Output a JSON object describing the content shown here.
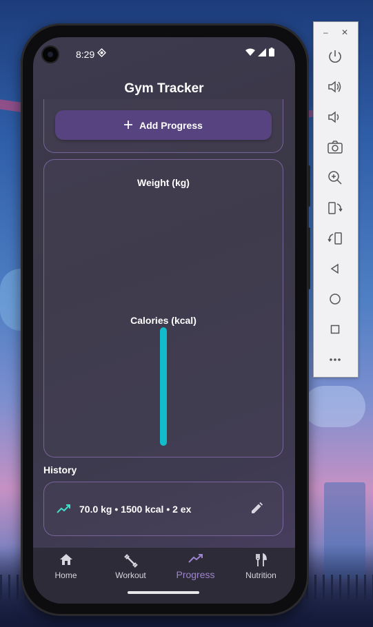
{
  "status_bar": {
    "time": "8:29"
  },
  "app": {
    "title": "Gym Tracker"
  },
  "add_progress": {
    "label": "Add Progress"
  },
  "chart": {
    "weight_title": "Weight (kg)",
    "calories_title": "Calories (kcal)"
  },
  "chart_data": {
    "type": "bar",
    "charts": [
      {
        "title": "Weight (kg)",
        "values": []
      },
      {
        "title": "Calories (kcal)",
        "values": [
          1500
        ]
      }
    ]
  },
  "history": {
    "label": "History",
    "items": [
      {
        "text": "70.0 kg • 1500 kcal • 2 ex"
      }
    ]
  },
  "nav": {
    "items": [
      {
        "label": "Home",
        "icon": "home-icon"
      },
      {
        "label": "Workout",
        "icon": "dumbbell-icon"
      },
      {
        "label": "Progress",
        "icon": "trending-up-icon",
        "active": true
      },
      {
        "label": "Nutrition",
        "icon": "restaurant-icon"
      }
    ]
  },
  "emulator": {
    "buttons": [
      "power-icon",
      "volume-up-icon",
      "volume-down-icon",
      "camera-icon",
      "zoom-icon",
      "rotate-left-icon",
      "rotate-right-icon",
      "back-icon",
      "home-circle-icon",
      "overview-icon",
      "more-icon"
    ]
  },
  "colors": {
    "accent": "#9f84cf",
    "bar": "#12bccb",
    "button": "#57437f",
    "trend": "#3fe0c8"
  }
}
